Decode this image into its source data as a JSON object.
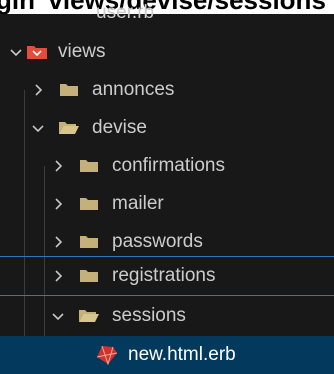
{
  "caption": {
    "text": "gin' views/devise/sessions"
  },
  "tree": {
    "items": [
      {
        "label": "user.rb",
        "type": "file"
      },
      {
        "label": "views",
        "type": "folder",
        "expanded": true,
        "icon": "views-folder-icon"
      },
      {
        "label": "annonces",
        "type": "folder",
        "expanded": false
      },
      {
        "label": "devise",
        "type": "folder",
        "expanded": true
      },
      {
        "label": "confirmations",
        "type": "folder",
        "expanded": false
      },
      {
        "label": "mailer",
        "type": "folder",
        "expanded": false
      },
      {
        "label": "passwords",
        "type": "folder",
        "expanded": false
      },
      {
        "label": "registrations",
        "type": "folder",
        "expanded": false
      },
      {
        "label": "sessions",
        "type": "folder",
        "expanded": true
      },
      {
        "label": "new.html.erb",
        "type": "file",
        "selected": true,
        "icon": "ruby-erb-file-icon"
      }
    ]
  },
  "colors": {
    "background": "#181818",
    "folder": "#c5b07a",
    "selected_row": "#04395e",
    "highlight_border": "#2b79c2",
    "views_icon": "#e44d3a",
    "ruby": "#cc342d"
  }
}
